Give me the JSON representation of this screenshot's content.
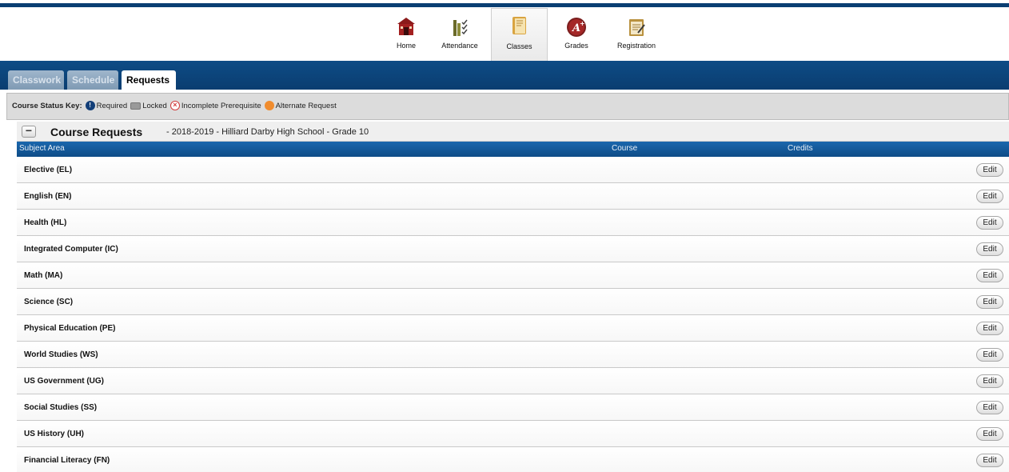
{
  "nav": {
    "items": [
      {
        "label": "Home",
        "icon": "school-house-icon"
      },
      {
        "label": "Attendance",
        "icon": "attendance-chart-icon"
      },
      {
        "label": "Classes",
        "icon": "book-icon"
      },
      {
        "label": "Grades",
        "icon": "a-plus-badge-icon"
      },
      {
        "label": "Registration",
        "icon": "registration-clipboard-icon"
      }
    ],
    "active": "Classes"
  },
  "tabs": [
    {
      "label": "Classwork"
    },
    {
      "label": "Schedule"
    },
    {
      "label": "Requests"
    }
  ],
  "active_tab": "Requests",
  "status_key": {
    "title": "Course Status Key:",
    "required": "Required",
    "locked": "Locked",
    "incomplete": "Incomplete Prerequisite",
    "alternate": "Alternate Request"
  },
  "course_requests": {
    "collapse_symbol": "−",
    "title": "Course Requests",
    "subtitle": "- 2018-2019 - Hilliard Darby High School - Grade 10"
  },
  "columns": {
    "subject_area": "Subject Area",
    "course": "Course",
    "credits": "Credits"
  },
  "rows": [
    {
      "subject": "Elective (EL)",
      "action": "Edit"
    },
    {
      "subject": "English (EN)",
      "action": "Edit"
    },
    {
      "subject": "Health (HL)",
      "action": "Edit"
    },
    {
      "subject": "Integrated Computer (IC)",
      "action": "Edit"
    },
    {
      "subject": "Math (MA)",
      "action": "Edit"
    },
    {
      "subject": "Science (SC)",
      "action": "Edit"
    },
    {
      "subject": "Physical Education (PE)",
      "action": "Edit"
    },
    {
      "subject": "World Studies (WS)",
      "action": "Edit"
    },
    {
      "subject": "US Government (UG)",
      "action": "Edit"
    },
    {
      "subject": "Social Studies (SS)",
      "action": "Edit"
    },
    {
      "subject": "US History (UH)",
      "action": "Edit"
    },
    {
      "subject": "Financial Literacy (FN)",
      "action": "Edit"
    }
  ],
  "colors": {
    "header_blue": "#0e4c86",
    "column_header_blue": "#1a67ad",
    "key_bar_gray": "#dcdcdc"
  }
}
